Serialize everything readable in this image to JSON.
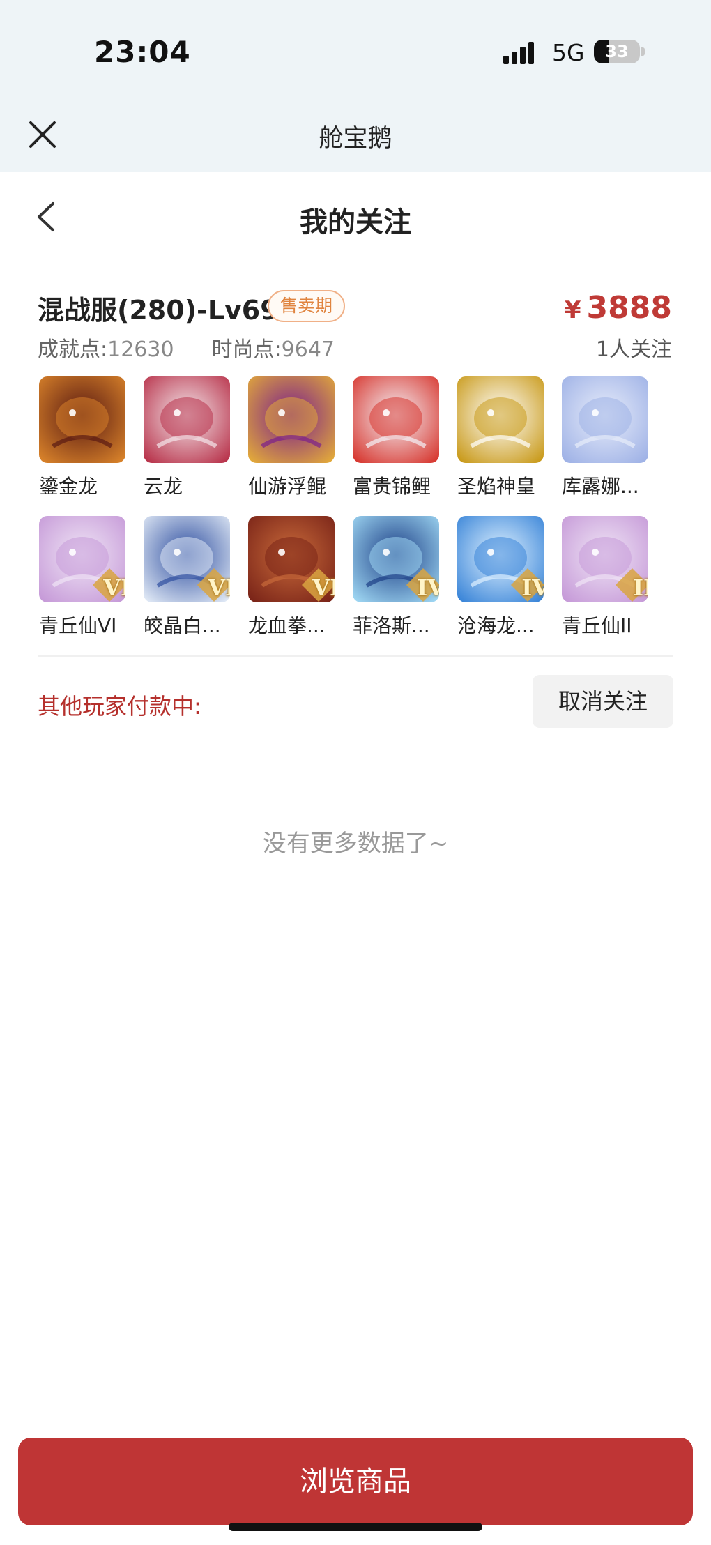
{
  "status_bar": {
    "time": "23:04",
    "network": "5G",
    "battery": "33",
    "battery_level": 0.33
  },
  "app_bar": {
    "title": "舱宝鹅"
  },
  "page": {
    "title": "我的关注"
  },
  "listing": {
    "server": "混战服(280)-Lv69",
    "badge": "售卖期",
    "price_symbol": "¥",
    "price": "3888",
    "achievement_label": "成就点:",
    "achievement_value": "12630",
    "fashion_label": "时尚点:",
    "fashion_value": "9647",
    "followers": "1人关注",
    "pets": [
      {
        "name": "鎏金龙",
        "icon": "golden-dragon-icon",
        "rank": "",
        "colors": [
          "#5a1a12",
          "#d8822a"
        ]
      },
      {
        "name": "云龙",
        "icon": "cloud-dragon-icon",
        "rank": "",
        "colors": [
          "#f3e6ea",
          "#b8324a"
        ]
      },
      {
        "name": "仙游浮鲲",
        "icon": "floating-kun-icon",
        "rank": "",
        "colors": [
          "#7a1f8c",
          "#e2a93a"
        ]
      },
      {
        "name": "富贵锦鲤",
        "icon": "koi-fish-icon",
        "rank": "",
        "colors": [
          "#f4f1f6",
          "#d7372f"
        ]
      },
      {
        "name": "圣焰神皇",
        "icon": "holy-flame-icon",
        "rank": "",
        "colors": [
          "#ffffff",
          "#c99a1a"
        ]
      },
      {
        "name": "库露娜...",
        "icon": "spirit-girl-icon",
        "rank": "",
        "colors": [
          "#e7ecfa",
          "#9fb2e6"
        ]
      },
      {
        "name": "青丘仙VI",
        "icon": "fox-fairy-icon",
        "rank": "VI",
        "colors": [
          "#efe4f5",
          "#c69ad8"
        ]
      },
      {
        "name": "皎晶白...",
        "icon": "white-tiger-icon",
        "rank": "VI",
        "colors": [
          "#2f4fa0",
          "#dfe8f5"
        ]
      },
      {
        "name": "龙血拳...",
        "icon": "dragon-blood-fist-icon",
        "rank": "VI",
        "colors": [
          "#c86a3a",
          "#7a2418"
        ]
      },
      {
        "name": "菲洛斯...",
        "icon": "phyllos-icon",
        "rank": "IV",
        "colors": [
          "#1d3f86",
          "#9ed6f2"
        ]
      },
      {
        "name": "沧海龙...",
        "icon": "sea-dragon-icon",
        "rank": "IV",
        "colors": [
          "#dff1ff",
          "#3a85d8"
        ]
      },
      {
        "name": "青丘仙II",
        "icon": "fox-fairy-icon",
        "rank": "II",
        "colors": [
          "#efe4f5",
          "#c69ad8"
        ]
      }
    ],
    "paying_label": "其他玩家付款中:",
    "unfollow_label": "取消关注"
  },
  "footer": {
    "no_more": "没有更多数据了~",
    "browse_label": "浏览商品"
  },
  "colors": {
    "accent": "#bf3535",
    "badge": "#e0843f",
    "header_bg": "#eef4f7"
  }
}
